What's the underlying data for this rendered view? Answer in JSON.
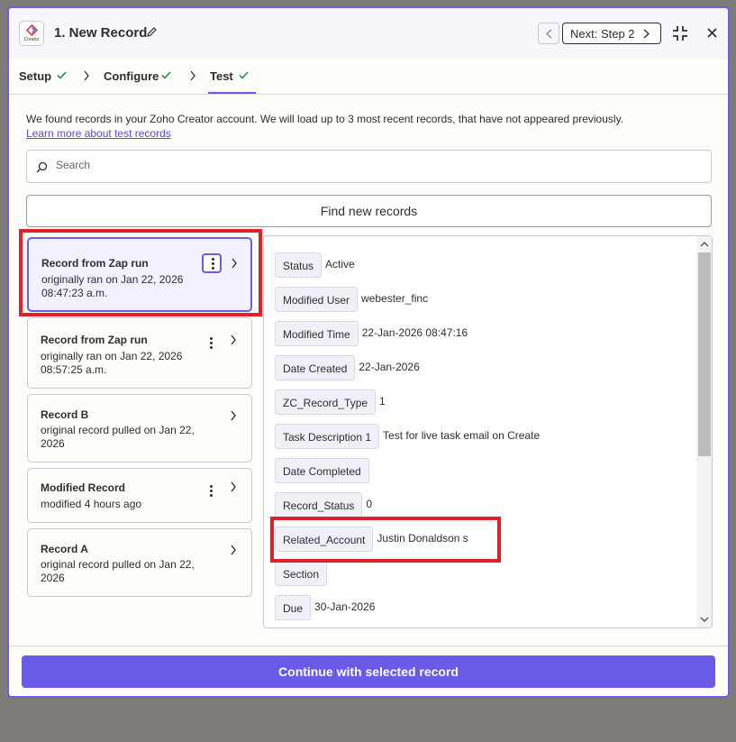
{
  "header": {
    "app_logo_text": "Creator",
    "title": "1. New Record",
    "next_label": "Next: Step 2"
  },
  "tabs": [
    {
      "label": "Setup",
      "status": "complete"
    },
    {
      "label": "Configure",
      "status": "complete"
    },
    {
      "label": "Test",
      "status": "complete",
      "active": true
    }
  ],
  "intro_text": "We found records in your Zoho Creator account. We will load up to 3 most recent records, that have not appeared previously.",
  "learn_link": "Learn more about test records",
  "search": {
    "placeholder": "Search",
    "value": ""
  },
  "find_button": "Find new records",
  "records": [
    {
      "title": "Record from Zap run",
      "sub": "originally ran on Jan 22, 2026 08:47:23 a.m.",
      "selected": true,
      "menu": true
    },
    {
      "title": "Record from Zap run",
      "sub": "originally ran on Jan 22, 2026 08:57:25 a.m.",
      "selected": false,
      "menu": true
    },
    {
      "title": "Record B",
      "sub": "original record pulled on Jan 22, 2026",
      "selected": false,
      "menu": false
    },
    {
      "title": "Modified Record",
      "sub": "modified 4 hours ago",
      "selected": false,
      "menu": true
    },
    {
      "title": "Record A",
      "sub": "original record pulled on Jan 22, 2026",
      "selected": false,
      "menu": false
    }
  ],
  "fields": [
    {
      "key": "Status",
      "value": "Active"
    },
    {
      "key": "Modified User",
      "value": "webester_finc"
    },
    {
      "key": "Modified Time",
      "value": "22-Jan-2026 08:47:16"
    },
    {
      "key": "Date Created",
      "value": "22-Jan-2026"
    },
    {
      "key": "ZC_Record_Type",
      "value": "1"
    },
    {
      "key": "Task Description 1",
      "value": "Test for live task email on Create"
    },
    {
      "key": "Date Completed",
      "value": ""
    },
    {
      "key": "Record_Status",
      "value": "0"
    },
    {
      "key": "Related_Account",
      "value": "Justin Donaldson s"
    },
    {
      "key": "Section",
      "value": ""
    },
    {
      "key": "Due",
      "value": "30-Jan-2026"
    }
  ],
  "continue_button": "Continue with selected record",
  "colors": {
    "accent": "#695be8",
    "highlight": "#e0212b",
    "check": "#1f8a3e"
  }
}
